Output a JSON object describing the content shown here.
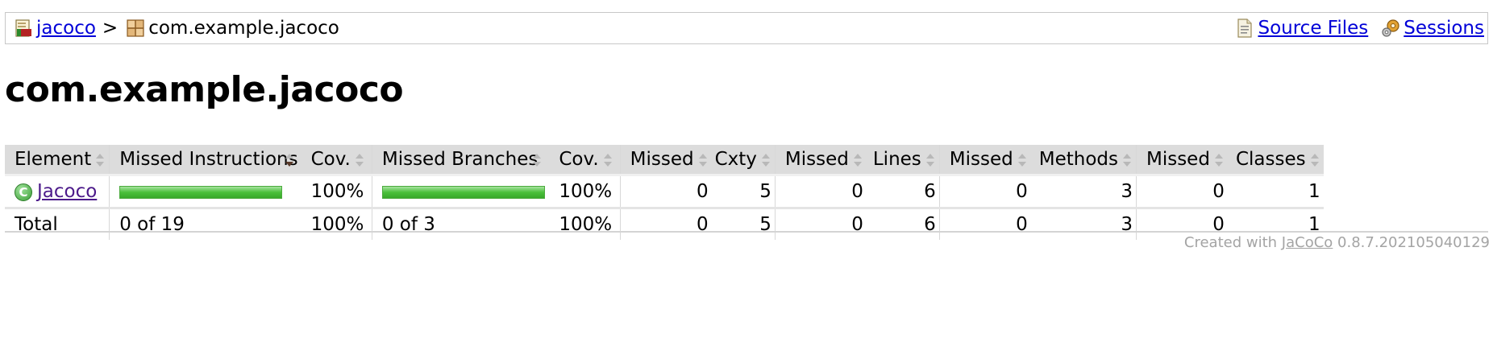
{
  "breadcrumb": {
    "root_link": "jacoco",
    "separator": ">",
    "current": "com.example.jacoco",
    "source_files": "Source Files",
    "sessions": "Sessions"
  },
  "page_title": "com.example.jacoco",
  "table": {
    "headers": {
      "element": "Element",
      "missed_instructions": "Missed Instructions",
      "cov1": "Cov.",
      "missed_branches": "Missed Branches",
      "cov2": "Cov.",
      "missed_cxty": "Missed",
      "cxty": "Cxty",
      "missed_lines": "Missed",
      "lines": "Lines",
      "missed_methods": "Missed",
      "methods": "Methods",
      "missed_classes": "Missed",
      "classes": "Classes"
    },
    "rows": [
      {
        "element": "Jacoco",
        "icon": "class-icon",
        "instructions_fraction": 1.0,
        "instructions_cov": "100%",
        "branches_fraction": 1.0,
        "branches_cov": "100%",
        "missed_cxty": "0",
        "cxty": "5",
        "missed_lines": "0",
        "lines": "6",
        "missed_methods": "0",
        "methods": "3",
        "missed_classes": "0",
        "classes": "1"
      }
    ],
    "total": {
      "label": "Total",
      "instructions": "0 of 19",
      "instructions_cov": "100%",
      "branches": "0 of 3",
      "branches_cov": "100%",
      "missed_cxty": "0",
      "cxty": "5",
      "missed_lines": "0",
      "lines": "6",
      "missed_methods": "0",
      "methods": "3",
      "missed_classes": "0",
      "classes": "1"
    }
  },
  "footer": {
    "prefix": "Created with",
    "link": "JaCoCo",
    "version": "0.8.7.202105040129"
  },
  "colors": {
    "link": "#0000d8",
    "visited_link": "#4c1a8a",
    "header_bg": "#dcdcdc",
    "bar_green": "#4ac03a",
    "footer_text": "#a4a4a4"
  }
}
